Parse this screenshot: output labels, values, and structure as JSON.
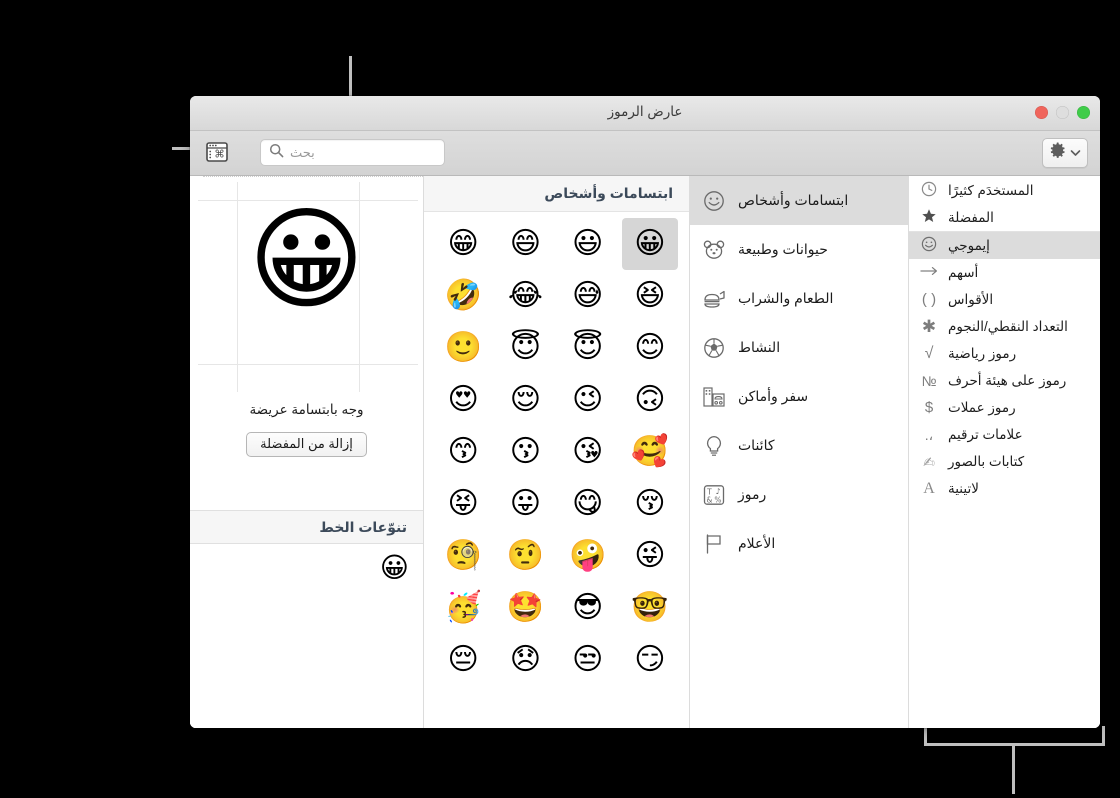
{
  "window": {
    "title": "عارض الرموز",
    "traffic_lights": [
      {
        "name": "minimize-button",
        "color": "#3fcc49"
      },
      {
        "name": "zoom-button",
        "color": "#dedede"
      },
      {
        "name": "close-button",
        "color": "#f0655c"
      }
    ]
  },
  "toolbar": {
    "panel_toggle_icon": "character-palette-icon",
    "search": {
      "placeholder": "بحث",
      "value": "",
      "icon": "search-icon"
    },
    "gear": {
      "icon": "gear-icon",
      "chevron": "chevron-down-icon"
    }
  },
  "sidebar": {
    "groups": [
      {
        "items": [
          {
            "glyph": "🕐",
            "icon_name": "clock-icon",
            "label": "المستخدَم كثيرًا",
            "selected": false
          },
          {
            "glyph": "★",
            "icon_name": "star-icon",
            "label": "المفضلة",
            "selected": false
          }
        ]
      },
      {
        "items": [
          {
            "glyph": "☺",
            "icon_name": "smiley-outline-icon",
            "label": "إيموجي",
            "selected": true
          },
          {
            "glyph": "→",
            "icon_name": "arrow-right-icon",
            "label": "أسهم",
            "selected": false
          },
          {
            "glyph": "( )",
            "icon_name": "parentheses-icon",
            "label": "الأقواس",
            "selected": false
          },
          {
            "glyph": "✳",
            "icon_name": "asterisk-icon",
            "label": "التعداد النقطي/النجوم",
            "selected": false
          },
          {
            "glyph": "√",
            "icon_name": "radical-icon",
            "label": "رموز رياضية",
            "selected": false
          },
          {
            "glyph": "№",
            "icon_name": "numero-icon",
            "label": "رموز على هيئة أحرف",
            "selected": false
          },
          {
            "glyph": "$",
            "icon_name": "dollar-icon",
            "label": "رموز عملات",
            "selected": false
          },
          {
            "glyph": "،.",
            "icon_name": "punctuation-icon",
            "label": "علامات ترقيم",
            "selected": false
          },
          {
            "glyph": "✍",
            "icon_name": "pictograph-icon",
            "label": "كتابات بالصور",
            "selected": false
          },
          {
            "glyph": "A",
            "icon_name": "latin-letter-icon",
            "label": "لاتينية",
            "selected": false
          }
        ]
      }
    ]
  },
  "categories": [
    {
      "icon": "☺",
      "icon_name": "smileys-people-icon",
      "label": "ابتسامات وأشخاص",
      "selected": true
    },
    {
      "icon": "🐻",
      "icon_name": "animals-nature-icon",
      "label": "حيوانات وطبيعة",
      "selected": false
    },
    {
      "icon": "🍔",
      "icon_name": "food-drink-icon",
      "label": "الطعام والشراب",
      "selected": false
    },
    {
      "icon": "⚽",
      "icon_name": "activity-icon",
      "label": "النشاط",
      "selected": false
    },
    {
      "icon": "🏙",
      "icon_name": "travel-places-icon",
      "label": "سفر وأماكن",
      "selected": false
    },
    {
      "icon": "💡",
      "icon_name": "objects-icon",
      "label": "كائنات",
      "selected": false
    },
    {
      "icon": "🔣",
      "icon_name": "symbols-icon",
      "label": "رموز",
      "selected": false
    },
    {
      "icon": "⚑",
      "icon_name": "flags-icon",
      "label": "الأعلام",
      "selected": false
    }
  ],
  "grid": {
    "header": "ابتسامات وأشخاص",
    "emojis": [
      {
        "char": "😀",
        "selected": true
      },
      {
        "char": "😃",
        "selected": false
      },
      {
        "char": "😄",
        "selected": false
      },
      {
        "char": "😁",
        "selected": false
      },
      {
        "char": "😆",
        "selected": false
      },
      {
        "char": "😅",
        "selected": false
      },
      {
        "char": "😂",
        "selected": false
      },
      {
        "char": "🤣",
        "selected": false
      },
      {
        "char": "😊",
        "selected": false
      },
      {
        "char": "😇",
        "selected": false
      },
      {
        "char": "😇",
        "selected": false
      },
      {
        "char": "🙂",
        "selected": false
      },
      {
        "char": "🙃",
        "selected": false
      },
      {
        "char": "😉",
        "selected": false
      },
      {
        "char": "😌",
        "selected": false
      },
      {
        "char": "😍",
        "selected": false
      },
      {
        "char": "🥰",
        "selected": false
      },
      {
        "char": "😘",
        "selected": false
      },
      {
        "char": "😗",
        "selected": false
      },
      {
        "char": "😙",
        "selected": false
      },
      {
        "char": "😚",
        "selected": false
      },
      {
        "char": "😋",
        "selected": false
      },
      {
        "char": "😛",
        "selected": false
      },
      {
        "char": "😝",
        "selected": false
      },
      {
        "char": "😜",
        "selected": false
      },
      {
        "char": "🤪",
        "selected": false
      },
      {
        "char": "🤨",
        "selected": false
      },
      {
        "char": "🧐",
        "selected": false
      },
      {
        "char": "🤓",
        "selected": false
      },
      {
        "char": "😎",
        "selected": false
      },
      {
        "char": "🤩",
        "selected": false
      },
      {
        "char": "🥳",
        "selected": false
      },
      {
        "char": "😏",
        "selected": false
      },
      {
        "char": "😒",
        "selected": false
      },
      {
        "char": "😞",
        "selected": false
      },
      {
        "char": "😔",
        "selected": false
      }
    ]
  },
  "preview": {
    "glyph": "😀",
    "name": "وجه بابتسامة عريضة",
    "favorite_button": "إزالة من المفضلة",
    "variants_header": "تنوّعات الخط",
    "variants": [
      "😀"
    ]
  }
}
